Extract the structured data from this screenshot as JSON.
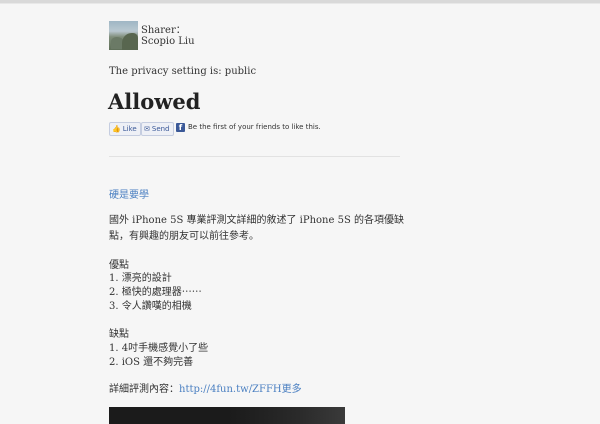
{
  "sharer": {
    "label": "Sharer：",
    "name": "Scopio Liu"
  },
  "privacy": "The privacy setting is: public",
  "status": "Allowed",
  "facebook": {
    "like_label": "Like",
    "send_label": "Send",
    "logo": "f",
    "social_text": "Be the first of your friends to like this."
  },
  "post": {
    "tag": "硬是要學",
    "intro_line1": "國外 iPhone 5S 專業評測文詳細的敘述了 iPhone 5S 的各項優缺",
    "intro_line2": "點，有興趣的朋友可以前往參考。",
    "pros_title": "優點",
    "pros": [
      "1. 漂亮的設計",
      "2. 極快的處理器⋯⋯",
      "3. 令人讚嘆的相機"
    ],
    "cons_title": "缺點",
    "cons": [
      "1. 4吋手機感覺小了些",
      "2. iOS 還不夠完善"
    ],
    "detail_label": "詳細評測內容：",
    "detail_link": "http://4fun.tw/ZFFH更多"
  },
  "icons": {
    "like": "thumbs-up-icon",
    "send": "envelope-icon",
    "facebook": "facebook-logo-icon"
  },
  "colors": {
    "link": "#4a7fc1",
    "facebook": "#3b5998",
    "background": "#f6f6f6"
  }
}
